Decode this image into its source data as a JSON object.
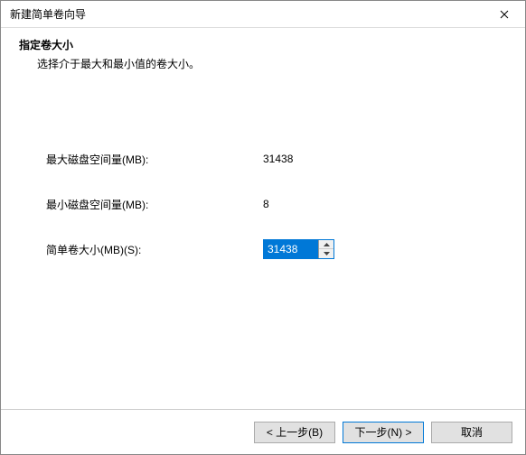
{
  "window": {
    "title": "新建简单卷向导"
  },
  "header": {
    "heading": "指定卷大小",
    "subheading": "选择介于最大和最小值的卷大小。"
  },
  "fields": {
    "max_label": "最大磁盘空间量(MB):",
    "max_value": "31438",
    "min_label": "最小磁盘空间量(MB):",
    "min_value": "8",
    "size_label": "简单卷大小(MB)(S):",
    "size_value": "31438"
  },
  "buttons": {
    "back": "< 上一步(B)",
    "next": "下一步(N) >",
    "cancel": "取消"
  }
}
